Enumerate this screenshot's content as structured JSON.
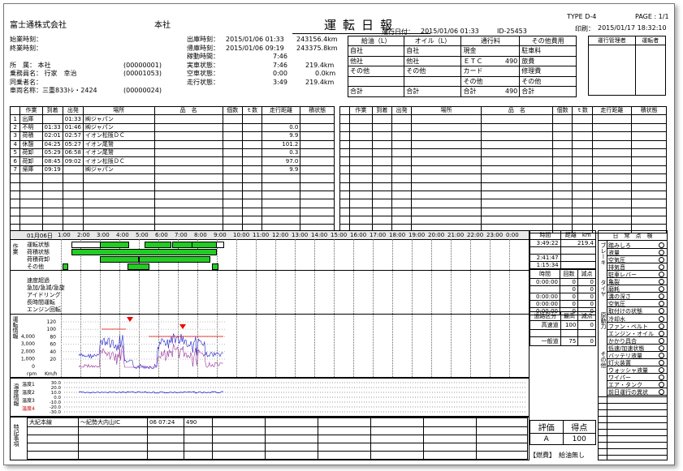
{
  "header": {
    "company": "富士通株式会社",
    "branch": "本社",
    "title": "運転日報",
    "run_date_label": "運行日付：",
    "run_date": "2015/01/06 01:33",
    "id": "ID-25453",
    "type": "TYPE D-4",
    "page": "PAGE : 1/1",
    "print_label": "印刷：",
    "print_date": "2015/01/17 18:32:10"
  },
  "info_left": [
    {
      "label": "始業時刻：",
      "value": ""
    },
    {
      "label": "終業時刻：",
      "value": ""
    },
    {
      "label": "所　属：",
      "value": "本社",
      "code": "(00000001)"
    },
    {
      "label": "乗務員名：",
      "value": "行家　幸治",
      "code": "(00001053)"
    },
    {
      "label": "同乗者名：",
      "value": "",
      "code": ""
    },
    {
      "label": "車両名称：",
      "value": "三重833ﾄﾚ・2424",
      "code": "(00000024)"
    }
  ],
  "info_mid": [
    {
      "label": "出庫時刻：",
      "value": "2015/01/06 01:33",
      "extra": "243156.4km"
    },
    {
      "label": "帰庫時刻：",
      "value": "2015/01/06 09:19",
      "extra": "243375.8km"
    },
    {
      "label": "稼動時間：",
      "value": "7:46",
      "extra": ""
    },
    {
      "label": "実車状態：",
      "value": "7:46",
      "extra": "219.4km"
    },
    {
      "label": "空車状態：",
      "value": "0:00",
      "extra": "0.0km"
    },
    {
      "label": "走行状態：",
      "value": "3:49",
      "extra": "219.4km"
    }
  ],
  "fees": {
    "headers": [
      "給油（L）",
      "オイル（L）",
      "通行料",
      "その他費用"
    ],
    "rows": [
      [
        "自社",
        "",
        "自社",
        "",
        "現金",
        "",
        "駐車料",
        ""
      ],
      [
        "他社",
        "",
        "他社",
        "",
        "ＥＴＣ",
        "490",
        "旅費",
        ""
      ],
      [
        "その他",
        "",
        "その他",
        "",
        "カード",
        "",
        "修理費",
        ""
      ],
      [
        "",
        "",
        "",
        "",
        "その他",
        "",
        "その他",
        ""
      ],
      [
        "合計",
        "",
        "合計",
        "",
        "合計",
        "490",
        "合計",
        ""
      ]
    ]
  },
  "managers": [
    "運行管理者",
    "運転者"
  ],
  "log": {
    "columns": [
      "作業",
      "到着",
      "出発",
      "場所",
      "品　名",
      "個数",
      "ｔ数",
      "走行距離",
      "積状態"
    ],
    "rows": [
      [
        "1",
        "出庫",
        "",
        "01:33",
        "㈱ジャパン",
        "",
        "",
        "",
        "",
        ""
      ],
      [
        "2",
        "不明",
        "01:33",
        "01:46",
        "㈱ジャパン",
        "",
        "",
        "",
        "0.0",
        ""
      ],
      [
        "3",
        "荷積",
        "02:01",
        "02:57",
        "イオン松阪ＤＣ",
        "",
        "",
        "",
        "9.9",
        ""
      ],
      [
        "4",
        "休憩",
        "04:25",
        "05:27",
        "イオン尾鷲",
        "",
        "",
        "",
        "101.2",
        ""
      ],
      [
        "5",
        "荷卸",
        "05:29",
        "06:58",
        "イオン尾鷲",
        "",
        "",
        "",
        "0.3",
        ""
      ],
      [
        "6",
        "荷卸",
        "08:45",
        "09:02",
        "イオン松阪ＤＣ",
        "",
        "",
        "",
        "97.0",
        ""
      ],
      [
        "7",
        "帰庫",
        "09:19",
        "",
        "㈱ジャパン",
        "",
        "",
        "",
        "9.9",
        ""
      ]
    ],
    "empty_rows": 7
  },
  "timeline": {
    "date": "01月06日",
    "hours": [
      "1:00",
      "2:00",
      "3:00",
      "4:00",
      "5:00",
      "6:00",
      "7:00",
      "8:00",
      "9:00",
      "10:00",
      "11:00",
      "12:00",
      "13:00",
      "14:00",
      "15:00",
      "16:00",
      "17:00",
      "18:00",
      "19:00",
      "20:00",
      "21:00",
      "22:00",
      "23:00",
      "0:00"
    ],
    "work_label": "作業",
    "work_rows": [
      "運転状態",
      "荷積状態",
      "荷積荷卸",
      "その他"
    ],
    "violation_label": "運転情報",
    "violation_rows": [
      "速度超過",
      "急加/急減/急旋",
      "アイドリング",
      "長時間運転",
      "エンジン回転"
    ],
    "speed_ticks": [
      "120",
      "100",
      "80",
      "60",
      "40",
      "20"
    ],
    "rpm_ticks": [
      "4,000",
      "3,000",
      "2,000",
      "1,000",
      "0"
    ],
    "rpm_label": "rpm",
    "kmh_label": "Km/h",
    "temp_label": "温度情報",
    "temp_rows": [
      "温度1",
      "温度2",
      "温度3",
      "温度4"
    ],
    "temp_ticks": [
      "30.0",
      "20.0",
      "10.0",
      "0.0",
      "-10.0",
      "-20.0",
      "-30.0"
    ],
    "comment_label": "特記事項",
    "comment": {
      "route": "大紀本線",
      "section": "～紀勢大内山IC",
      "time": "06 07:24",
      "fee": "490"
    }
  },
  "summary": {
    "col1": "時間",
    "col2": "距離　km",
    "rows1": [
      [
        "3:49:22",
        "219.4"
      ],
      [
        "",
        ""
      ],
      [
        "2:41:47",
        ""
      ],
      [
        "1:15:34",
        ""
      ]
    ],
    "sub_headers": [
      "時間",
      "回数",
      "減点"
    ],
    "rows2": [
      [
        "0:00:00",
        "0",
        "0"
      ],
      [
        "",
        "0",
        "0"
      ],
      [
        "0:00:00",
        "0",
        "0"
      ],
      [
        "0:00:00",
        "0",
        "0"
      ],
      [
        "0:00:00",
        "0",
        "0"
      ]
    ],
    "road_headers": [
      "道路区分",
      "最高",
      "減点"
    ],
    "road_rows": [
      [
        "高速道",
        "100",
        "0"
      ],
      [
        "",
        "",
        ""
      ],
      [
        "一般道",
        "75",
        "0"
      ]
    ]
  },
  "daily_check": {
    "title": "日　常　点　検",
    "groups": [
      "ブレーキ",
      "タイヤ",
      "原動力",
      "その他"
    ],
    "items": [
      "踏みしろ",
      "液量",
      "空気圧",
      "排気音",
      "駐車レバー",
      "亀裂",
      "磨耗",
      "溝の深さ",
      "空気圧",
      "取付けの状態",
      "冷却水",
      "ファン・ベルト",
      "エンジン・オイル",
      "かかり具合",
      "低速/加速状態",
      "バッテリ液量",
      "灯火装置",
      "ウォッシャ液量",
      "ワイパー",
      "エア・タンク",
      "前日運行の異状"
    ]
  },
  "evaluation": {
    "label": "評価",
    "grade": "A",
    "score_label": "得点",
    "score": "100",
    "fuel_note": "【燃費】　給油無し"
  }
}
